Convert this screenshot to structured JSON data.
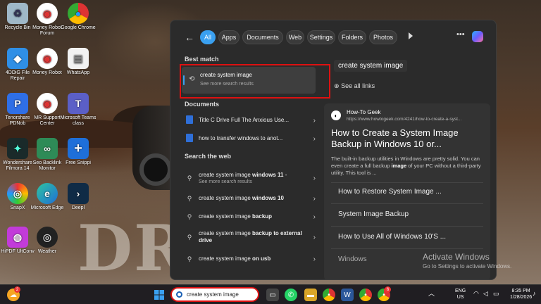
{
  "desktop": {
    "icons": [
      {
        "label": "Recycle Bin",
        "icon": "recycle-bin-icon",
        "color": "#9fb8c8",
        "glyph": "♻"
      },
      {
        "label": "Money Robot Forum",
        "icon": "chrome-icon",
        "color": "#ffffff",
        "glyph": "◉"
      },
      {
        "label": "Google Chrome",
        "icon": "chrome-icon",
        "color": "#ffffff",
        "glyph": "◉"
      },
      {
        "label": "4DDiG File Repair",
        "icon": "file-repair-icon",
        "color": "#2f8fe6",
        "glyph": "◆"
      },
      {
        "label": "Money Robot",
        "icon": "chrome-icon",
        "color": "#ffffff",
        "glyph": "◉"
      },
      {
        "label": "WhatsApp",
        "icon": "document-icon",
        "color": "#f2f2f2",
        "glyph": "▤"
      },
      {
        "label": "Tenorshare PDNob",
        "icon": "pdnob-icon",
        "color": "#2f6fe6",
        "glyph": "P"
      },
      {
        "label": "MR Support Center",
        "icon": "chrome-icon",
        "color": "#ffffff",
        "glyph": "◉"
      },
      {
        "label": "Microsoft Teams class",
        "icon": "teams-icon",
        "color": "#5b5fc7",
        "glyph": "T"
      },
      {
        "label": "Wondershare Filmora 14",
        "icon": "filmora-icon",
        "color": "#1a2a2a",
        "glyph": "✦"
      },
      {
        "label": "Seo Backlink Monitor",
        "icon": "seo-backlink-icon",
        "color": "#2e8b57",
        "glyph": "∞"
      },
      {
        "label": "Free Snippi",
        "icon": "snippi-icon",
        "color": "#1e6fd9",
        "glyph": "+"
      },
      {
        "label": "SnapX",
        "icon": "snapx-icon",
        "color": "#e8e8e8",
        "glyph": "◎"
      },
      {
        "label": "Microsoft Edge",
        "icon": "edge-icon",
        "color": "#1f9ad6",
        "glyph": "e"
      },
      {
        "label": "Deepl",
        "icon": "deepl-icon",
        "color": "#0f2b46",
        "glyph": "›"
      },
      {
        "label": "HiPDF UltConv",
        "icon": "hipdf-icon",
        "color": "#c23bd9",
        "glyph": "◍"
      },
      {
        "label": "Weather",
        "icon": "weather-icon",
        "color": "#222222",
        "glyph": "◎"
      }
    ],
    "background_text": "DREA"
  },
  "search_panel": {
    "tabs": [
      "All",
      "Apps",
      "Documents",
      "Web",
      "Settings",
      "Folders",
      "Photos"
    ],
    "best_match_heading": "Best match",
    "best_match": {
      "title": "create system image",
      "subtitle": "See more search results"
    },
    "documents_heading": "Documents",
    "documents": [
      "Title C Drive Full The Anxious Use...",
      "how to transfer windows to anot..."
    ],
    "web_heading": "Search the web",
    "web_results": [
      {
        "prefix": "create system image ",
        "bold": "windows 11",
        "suffix": " -",
        "sub": "See more search results"
      },
      {
        "prefix": "create system image ",
        "bold": "windows 10",
        "suffix": "",
        "sub": ""
      },
      {
        "prefix": "create system image ",
        "bold": "backup",
        "suffix": "",
        "sub": ""
      },
      {
        "prefix": "create system image ",
        "bold": "backup to external drive",
        "suffix": "",
        "sub": ""
      },
      {
        "prefix": "create system image ",
        "bold": "on usb",
        "suffix": "",
        "sub": ""
      }
    ],
    "right": {
      "query_title": "create system image",
      "see_all": "See all links",
      "site_name": "How-To Geek",
      "site_url": "https://www.howtogeek.com/4241/how-to-create-a-syst...",
      "headline": "How to Create a System Image Backup in Windows 10 or...",
      "snippet_parts": [
        "The built-in backup utilities in Windows are pretty solid. You can even create a full backup ",
        "image",
        " of your PC without a third-party utility. This tool is ..."
      ],
      "links": [
        "How to Restore System Image ...",
        "System Image Backup",
        "How to Use All of Windows 10'S ...",
        "Windows"
      ]
    }
  },
  "watermark": {
    "line1": "Activate Windows",
    "line2": "Go to Settings to activate Windows."
  },
  "taskbar": {
    "search_text": "create system image",
    "weather_badge": "2",
    "chrome_badge": "6",
    "lang_top": "ENG",
    "lang_bottom": "US",
    "time": "8:35 PM",
    "date": "1/28/2026",
    "accent": "#3aa0f0"
  }
}
